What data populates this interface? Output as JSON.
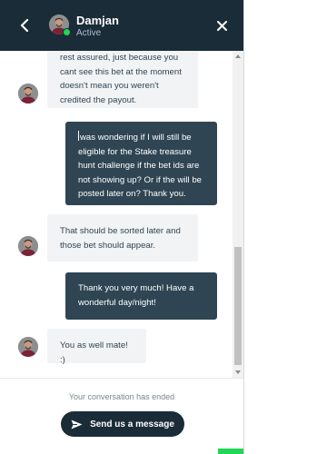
{
  "header": {
    "agent_name": "Damjan",
    "agent_status": "Active",
    "back_icon": "chevron-left-icon",
    "close_icon": "close-icon"
  },
  "messages": [
    {
      "sender": "agent",
      "lines": [
        "rest assured, just because you",
        "cant see this bet at the moment",
        "doesn't mean you weren't",
        "credited the payout."
      ]
    },
    {
      "sender": "user",
      "lines": [
        "was wondering if I will still be",
        "eligible for the Stake treasure",
        "hunt challenge if the bet ids are",
        "not showing up? Or if the will be",
        "posted later on? Thank you."
      ]
    },
    {
      "sender": "agent",
      "lines": [
        "That should be sorted later and",
        "those bet should appear."
      ]
    },
    {
      "sender": "user",
      "lines": [
        "Thank you very much! Have a",
        "wonderful day/night!"
      ]
    },
    {
      "sender": "agent",
      "lines": [
        "You as well mate! :)"
      ]
    }
  ],
  "footer": {
    "ended_text": "Your conversation has ended",
    "send_label": "Send us a message",
    "send_icon": "paper-plane-icon"
  },
  "colors": {
    "header_bg": "#1a2c38",
    "user_bubble": "#2f4553",
    "agent_bubble": "#f2f3f5",
    "online": "#1fd655"
  }
}
